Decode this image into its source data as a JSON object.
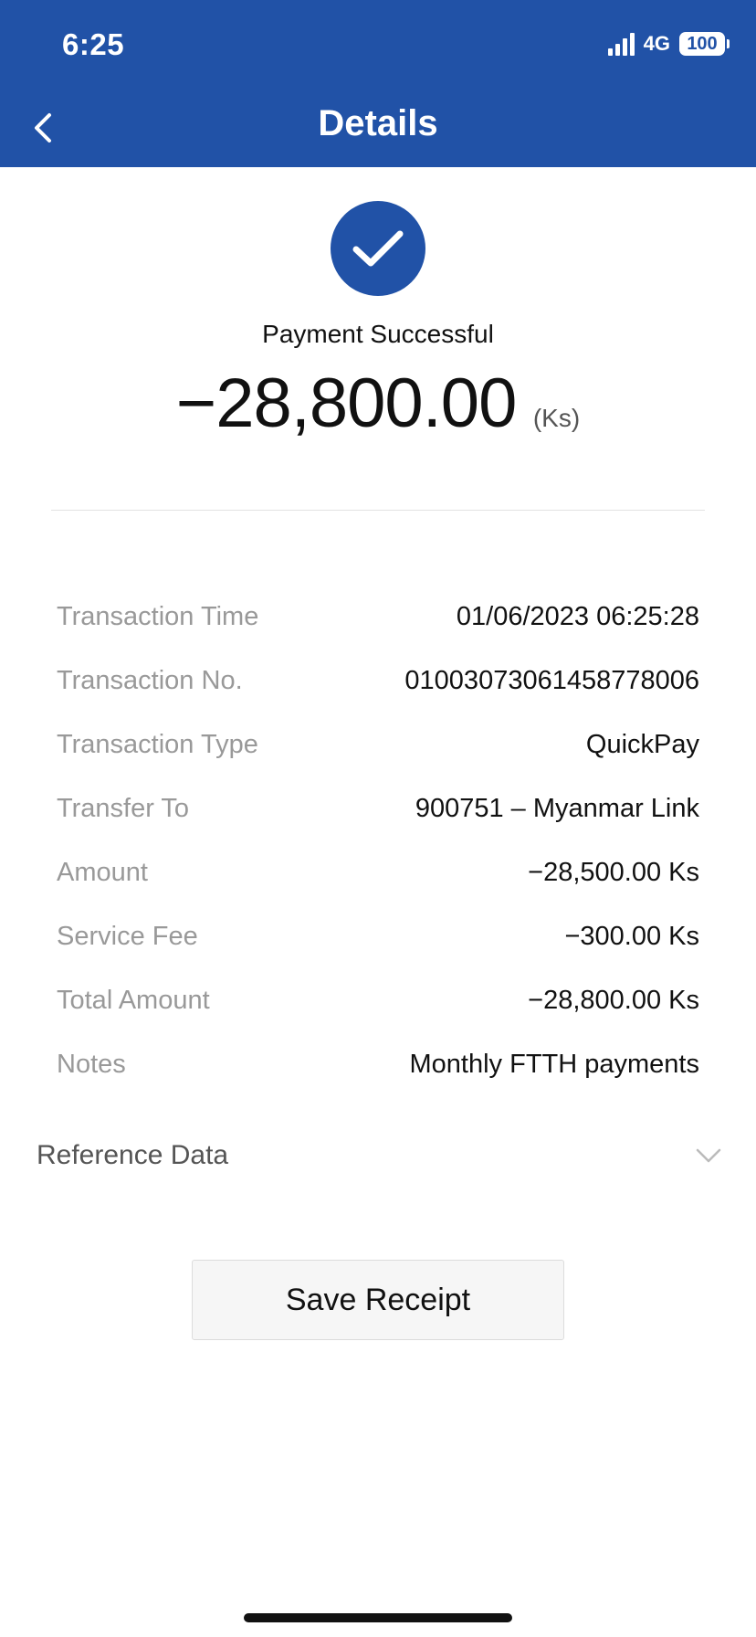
{
  "status_bar": {
    "time": "6:25",
    "network": "4G",
    "battery": "100"
  },
  "header": {
    "title": "Details"
  },
  "result": {
    "status_text": "Payment Successful",
    "amount": "−28,800.00",
    "currency": "(Ks)"
  },
  "details": [
    {
      "label": "Transaction Time",
      "value": "01/06/2023 06:25:28"
    },
    {
      "label": "Transaction No.",
      "value": "01003073061458778006"
    },
    {
      "label": "Transaction Type",
      "value": "QuickPay"
    },
    {
      "label": "Transfer To",
      "value": "900751 – Myanmar Link"
    },
    {
      "label": "Amount",
      "value": "−28,500.00 Ks"
    },
    {
      "label": "Service Fee",
      "value": "−300.00 Ks"
    },
    {
      "label": "Total Amount",
      "value": "−28,800.00 Ks"
    },
    {
      "label": "Notes",
      "value": "Monthly FTTH payments"
    }
  ],
  "reference": {
    "label": "Reference Data",
    "icon": "chevron-down-icon"
  },
  "actions": {
    "save_label": "Save Receipt"
  },
  "colors": {
    "brand": "#2152A7",
    "label_gray": "#999999"
  }
}
